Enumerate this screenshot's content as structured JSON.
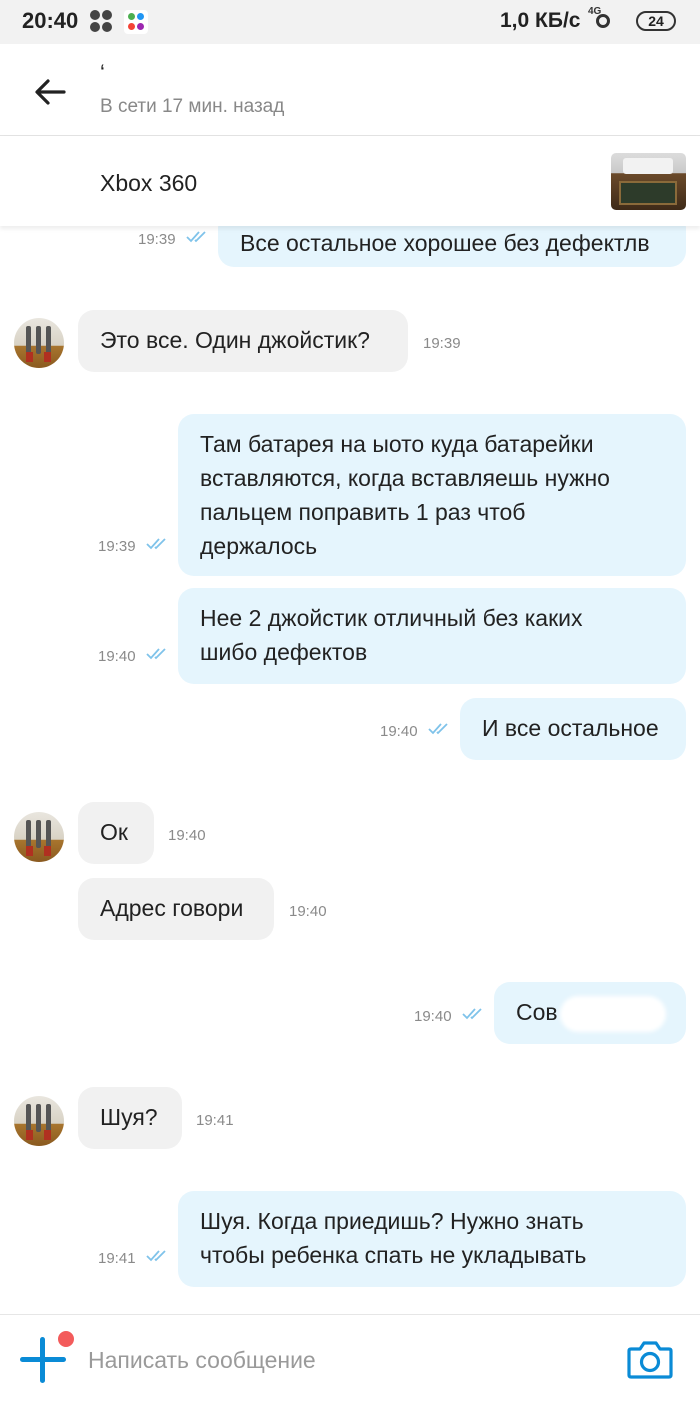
{
  "status_bar": {
    "time": "20:40",
    "network_speed": "1,0 КБ/с",
    "signal_label": "4G",
    "battery": "24"
  },
  "header": {
    "contact_name": "‘",
    "contact_status": "В сети 17 мин. назад",
    "back_icon": "arrow-left-icon"
  },
  "ad": {
    "title": "Xbox 360"
  },
  "messages": [
    {
      "direction": "out",
      "text": "Все остальное хорошее без дефектлв",
      "time": "19:39",
      "read": true
    },
    {
      "direction": "in",
      "text": "Это все. Один джойстик?",
      "time": "19:39"
    },
    {
      "direction": "out",
      "text": "Там батарея на ыото куда батарейки\nвставляются, когда вставляешь нужно\nпальцем поправить 1 раз чтоб\nдержалось",
      "time": "19:39",
      "read": true
    },
    {
      "direction": "out",
      "text": "Нее 2 джойстик отличный без каких\nшибо дефектов",
      "time": "19:40",
      "read": true
    },
    {
      "direction": "out",
      "text": "И все остальное",
      "time": "19:40",
      "read": true
    },
    {
      "direction": "in",
      "text": "Ок",
      "time": "19:40"
    },
    {
      "direction": "in",
      "text": "Адрес говори",
      "time": "19:40"
    },
    {
      "direction": "out",
      "text": "Сов",
      "time": "19:40",
      "read": true
    },
    {
      "direction": "in",
      "text": "Шуя?",
      "time": "19:41"
    },
    {
      "direction": "out",
      "text": "Шуя. Когда приедишь? Нужно знать\nчтобы ребенка спать не укладывать",
      "time": "19:41",
      "read": true
    }
  ],
  "composer": {
    "placeholder": "Написать сообщение",
    "add_icon": "plus-icon",
    "camera_icon": "camera-icon"
  },
  "colors": {
    "accent": "#0a8bd6",
    "incoming_bubble": "#f1f1f1",
    "outgoing_bubble": "#e5f5fd",
    "read_check": "#7fc3ea",
    "notification_dot": "#f35b5b"
  }
}
